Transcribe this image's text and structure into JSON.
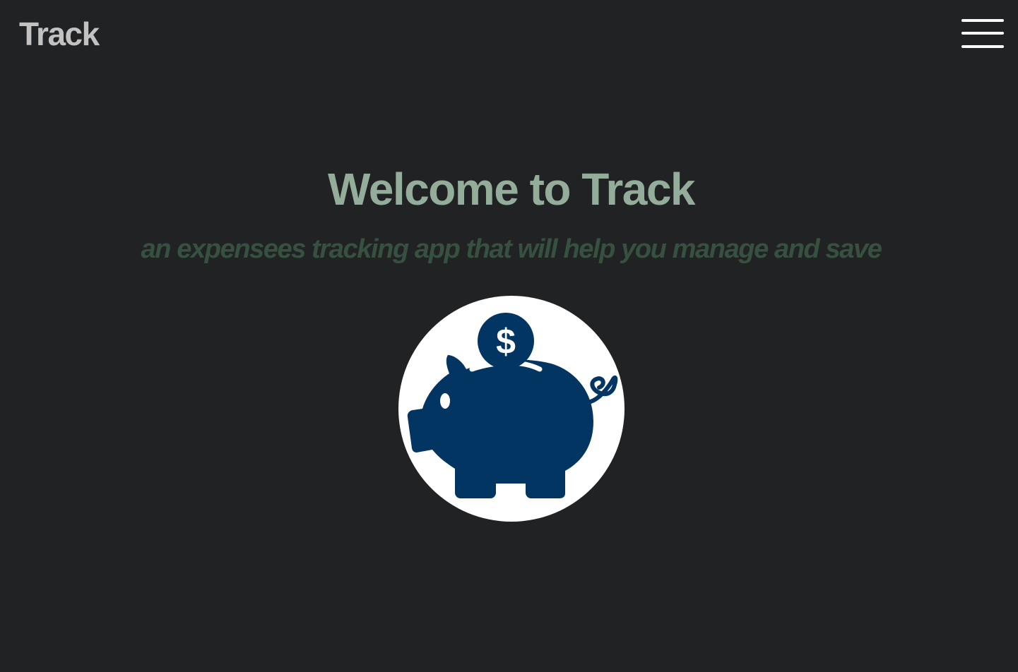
{
  "navbar": {
    "brand": "Track",
    "menu_icon": "hamburger-menu-icon"
  },
  "hero": {
    "title": "Welcome to Track",
    "subtitle": "an expensees tracking app that will help you manage and save",
    "image_icon": "piggy-bank-icon",
    "coin_symbol": "$"
  },
  "colors": {
    "background": "#212224",
    "brand": "#c2c2c2",
    "title": "#93ad9a",
    "subtitle": "#36513f",
    "piggy": "#033563",
    "logo_circle": "#ffffff"
  }
}
